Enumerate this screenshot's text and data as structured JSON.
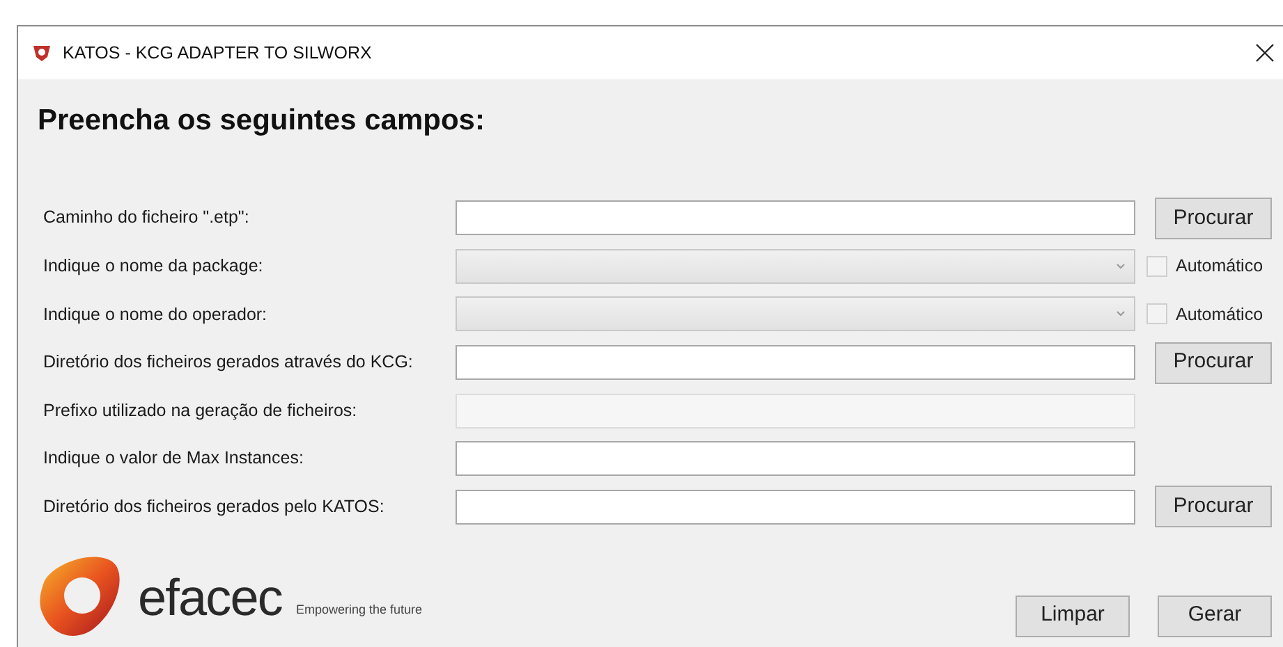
{
  "window": {
    "title": "KATOS - KCG ADAPTER TO SILWORX"
  },
  "heading": "Preencha os seguintes campos:",
  "rows": [
    {
      "label": "Caminho do ficheiro \".etp\":",
      "kind": "text",
      "disabled": false,
      "button": "Procurar"
    },
    {
      "label": "Indique o nome da package:",
      "kind": "dropdown",
      "disabled": true,
      "checkbox": {
        "label": "Automático",
        "checked": false
      }
    },
    {
      "label": "Indique o nome do operador:",
      "kind": "dropdown",
      "disabled": true,
      "checkbox": {
        "label": "Automático",
        "checked": false
      }
    },
    {
      "label": "Diretório dos ficheiros gerados através do KCG:",
      "kind": "text",
      "disabled": false,
      "button": "Procurar"
    },
    {
      "label": "Prefixo utilizado na geração de ficheiros:",
      "kind": "text",
      "disabled": true
    },
    {
      "label": "Indique o valor de Max Instances:",
      "kind": "text",
      "disabled": false
    },
    {
      "label": "Diretório dos ficheiros gerados pelo KATOS:",
      "kind": "text",
      "disabled": false,
      "button": "Procurar"
    }
  ],
  "logo": {
    "name": "efacec",
    "tagline": "Empowering the future"
  },
  "buttons": [
    "Limpar",
    "Gerar"
  ]
}
